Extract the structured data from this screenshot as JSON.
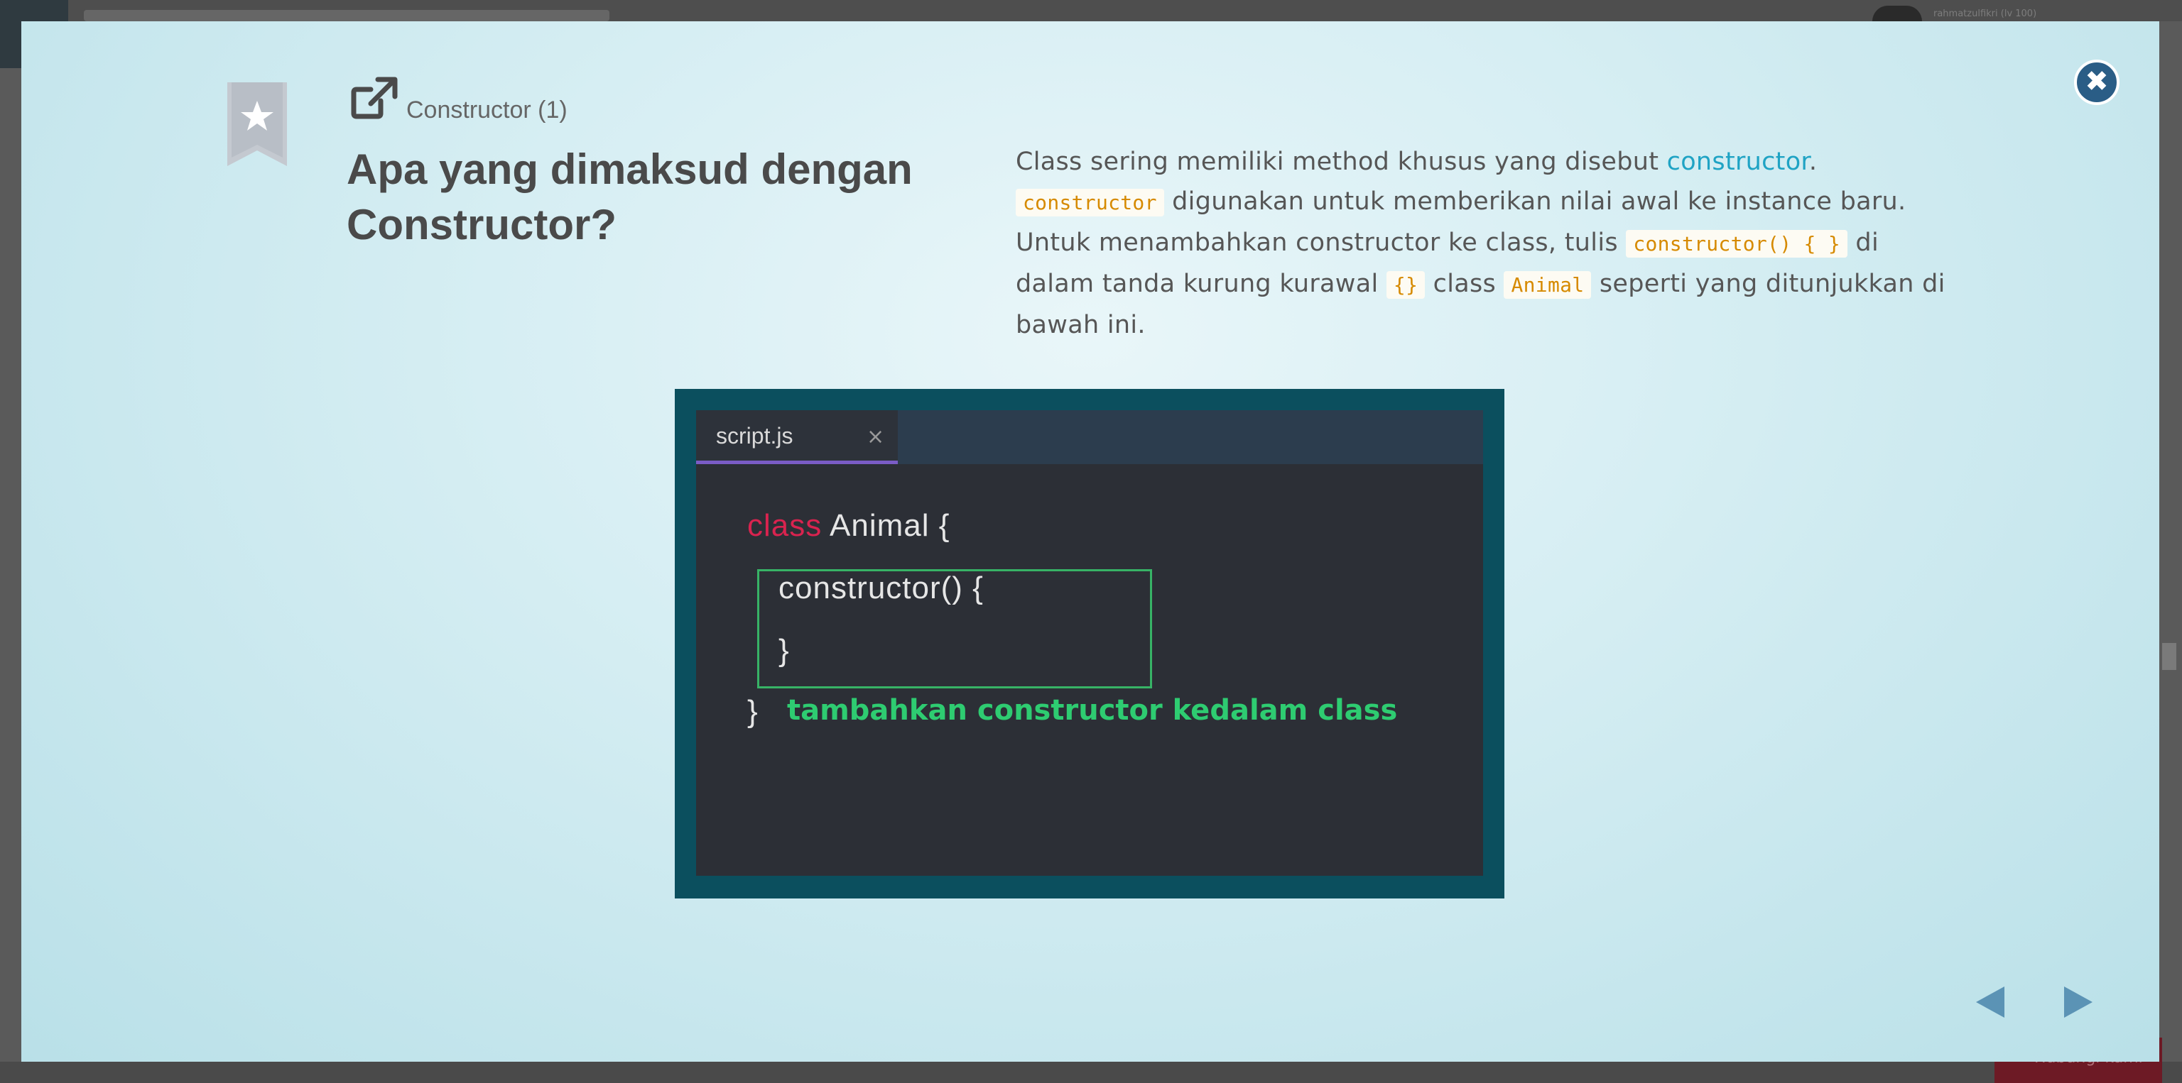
{
  "background": {
    "username": "rahmatzulfikri (lv 100)",
    "bottom_button": "Hubungi kami"
  },
  "modal": {
    "lesson_label": "Constructor (1)",
    "title": "Apa yang dimaksud dengan Constructor?",
    "description": {
      "p1_text": "Class sering memiliki method khusus yang disebut ",
      "p1_link": "constructor",
      "p1_end": ".",
      "p2_code": "constructor",
      "p2_text": " digunakan untuk memberikan nilai awal ke instance baru. Untuk menambahkan constructor ke class, tulis ",
      "p2_code2": "constructor() { }",
      "p2_text2": " di dalam tanda kurung kurawal ",
      "p2_code3": "{}",
      "p2_text3": " class ",
      "p2_code4": "Animal",
      "p2_text4": " seperti yang ditunjukkan di bawah ini."
    },
    "editor": {
      "tab_name": "script.js",
      "tab_close": "×",
      "line1_kw": "class",
      "line1_rest": " Animal {",
      "line2": "constructor() {",
      "line3": "}",
      "line4": "}",
      "annotation": "tambahkan constructor kedalam class"
    },
    "close_label": "✖"
  },
  "colors": {
    "accent": "#2a5d86",
    "link": "#1fa3c4",
    "code": "#d68a00",
    "keyword": "#d9234f",
    "annotation": "#2ecc71"
  },
  "icons": [
    "close-icon",
    "bookmark-star-icon",
    "external-link-icon",
    "prev-arrow-icon",
    "next-arrow-icon"
  ]
}
